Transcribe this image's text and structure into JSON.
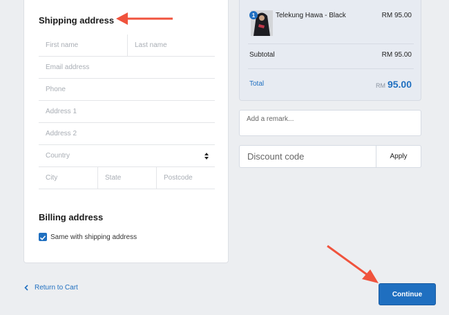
{
  "shipping": {
    "title": "Shipping address",
    "first_name_placeholder": "First name",
    "last_name_placeholder": "Last name",
    "email_placeholder": "Email address",
    "phone_placeholder": "Phone",
    "address1_placeholder": "Address 1",
    "address2_placeholder": "Address 2",
    "country_placeholder": "Country",
    "city_placeholder": "City",
    "state_placeholder": "State",
    "postcode_placeholder": "Postcode"
  },
  "billing": {
    "title": "Billing address",
    "same_as_shipping_label": "Same with shipping address",
    "same_as_shipping_checked": true
  },
  "summary": {
    "item": {
      "name": "Telekung Hawa - Black",
      "quantity": "1",
      "price": "RM 95.00"
    },
    "subtotal_label": "Subtotal",
    "subtotal_value": "RM 95.00",
    "total_label": "Total",
    "total_currency": "RM",
    "total_value": "95.00"
  },
  "remark": {
    "placeholder": "Add a remark..."
  },
  "discount": {
    "placeholder": "Discount code",
    "apply_label": "Apply"
  },
  "footer": {
    "return_label": "Return to Cart",
    "continue_label": "Continue"
  },
  "colors": {
    "accent": "#1f6fc0",
    "annotation_arrow": "#f0533d"
  },
  "icons": [
    "chevron-left-icon",
    "select-caret-icon",
    "check-icon",
    "annotation-arrow-icon"
  ]
}
